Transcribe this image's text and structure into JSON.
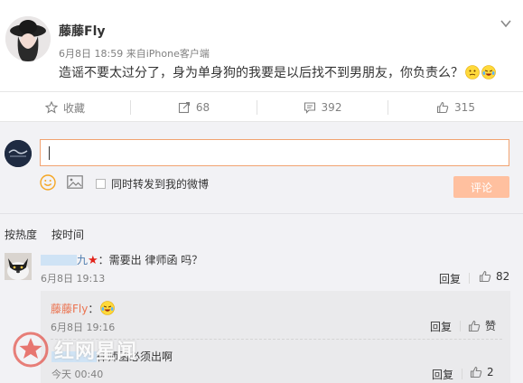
{
  "post": {
    "author": "藤藤Fly",
    "date": "6月8日 18:59",
    "source_prefix": "来自",
    "source": "iPhone客户端",
    "text": "造谣不要太过分了，身为单身狗的我要是以后找不到男朋友，你负责么？"
  },
  "actions": {
    "favorite_label": "收藏",
    "repost_count": "68",
    "comment_count": "392",
    "like_count": "315"
  },
  "composer": {
    "input_value": "",
    "sync_label": "同时转发到我的微博",
    "submit_label": "评论"
  },
  "sort": {
    "by_hot": "按热度",
    "by_time": "按时间"
  },
  "comments": [
    {
      "name_suffix": "九",
      "text": "：需要出 律师函 吗？",
      "date": "6月8日 19:13",
      "reply_label": "回复",
      "like_count": "82",
      "replies": [
        {
          "name": "藤藤Fly",
          "text": "：",
          "date": "6月8日 19:16",
          "reply_label": "回复",
          "like_label": "赞"
        },
        {
          "text": "律师函必须出啊",
          "date": "今天 00:40",
          "reply_label": "回复",
          "like_count": "2"
        }
      ]
    }
  ],
  "watermark": {
    "text": "红网星闻"
  },
  "colors": {
    "accent_orange": "#eb7350",
    "button_disabled": "#ffc09f",
    "input_border": "#f1a371",
    "panel_bg": "#f2f2f5"
  }
}
